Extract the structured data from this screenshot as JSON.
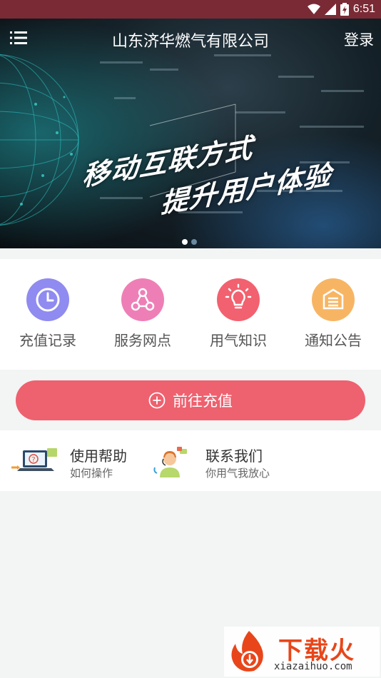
{
  "status_bar": {
    "time": "6:51"
  },
  "header": {
    "title": "山东济华燃气有限公司",
    "login_label": "登录"
  },
  "banner": {
    "slogan_line1": "移动互联方式",
    "slogan_line2": "提升用户体验",
    "active_slide": 1,
    "slide_count": 2
  },
  "quick_actions": [
    {
      "label": "充值记录",
      "icon": "clock-icon",
      "color": "#8f8bf0"
    },
    {
      "label": "服务网点",
      "icon": "network-nodes-icon",
      "color": "#ee7fb6"
    },
    {
      "label": "用气知识",
      "icon": "lightbulb-icon",
      "color": "#f2616f"
    },
    {
      "label": "通知公告",
      "icon": "notice-document-icon",
      "color": "#f7b564"
    }
  ],
  "recharge": {
    "label": "前往充值",
    "icon": "plus-circle-icon",
    "color": "#ee616f"
  },
  "help_links": [
    {
      "title": "使用帮助",
      "subtitle": "如何操作",
      "icon": "laptop-help-icon"
    },
    {
      "title": "联系我们",
      "subtitle": "你用气我放心",
      "icon": "customer-service-icon"
    }
  ],
  "watermark": {
    "brand": "下载火",
    "url": "xiazaihuo.com"
  }
}
